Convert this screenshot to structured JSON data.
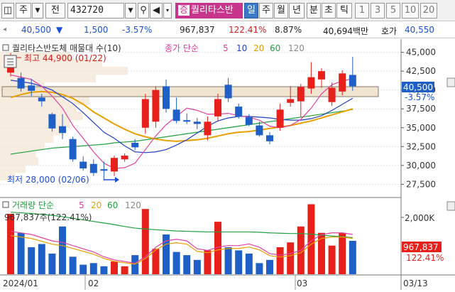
{
  "toolbar": {
    "type_label": "주",
    "prev_label": "전",
    "code": "432720",
    "stock_badge": "증",
    "stock_name": "퀄리타스반",
    "periods": [
      "일",
      "주",
      "월",
      "년",
      "분",
      "초",
      "틱"
    ],
    "selected_period": "일",
    "numbers": [
      "1",
      "3",
      "5",
      "10",
      "20"
    ]
  },
  "quote": {
    "price": "40,500",
    "change_arrow": "▼",
    "change": "1,500",
    "change_pct": "-3.57%",
    "volume": "967,837",
    "volume_ratio": "122.41%",
    "turnover": "8.87%",
    "amount": "40,694백만",
    "ask_label": "호가",
    "ask": "40,550"
  },
  "price_panel": {
    "title": "퀄리타스반도체 매물대 수(10)",
    "ma_label": "종가 단순",
    "ma_periods": [
      "5",
      "10",
      "20",
      "60",
      "120"
    ],
    "high_label": "최고 44,900 (01/22)",
    "low_label": "최저 28,000 (02/06)",
    "current_tag": "40,500",
    "current_pct": "-3.57%",
    "y_ticks": [
      "45,000",
      "42,500",
      "40,000",
      "37,500",
      "35,000",
      "32,500",
      "30,000",
      "27,500"
    ]
  },
  "volume_panel": {
    "title": "거래량 단순",
    "ma_periods": [
      "5",
      "20",
      "60",
      "120"
    ],
    "current_label": "967,837주(122.41%)",
    "y_tick": "2,000K",
    "current_tag": "967,837",
    "current_pct": "122.41%"
  },
  "x_labels": [
    "2024/01",
    "02",
    "03",
    "03/13"
  ],
  "colors": {
    "up": "#e8201c",
    "down": "#1e5fc8",
    "ma5": "#e040a0",
    "ma10": "#2040c0",
    "ma20": "#e8a000",
    "ma60": "#20a040",
    "ma120": "#888888"
  },
  "chart_data": {
    "type": "candlestick",
    "ylim": [
      26500,
      46000
    ],
    "candles": [
      {
        "o": 42300,
        "h": 44900,
        "l": 41800,
        "c": 43800
      },
      {
        "o": 41600,
        "h": 42300,
        "l": 39800,
        "c": 40200
      },
      {
        "o": 40600,
        "h": 41500,
        "l": 39200,
        "c": 39900
      },
      {
        "o": 39000,
        "h": 39500,
        "l": 37800,
        "c": 38500
      },
      {
        "o": 36800,
        "h": 37000,
        "l": 34500,
        "c": 34900
      },
      {
        "o": 35200,
        "h": 36800,
        "l": 33500,
        "c": 34300
      },
      {
        "o": 33500,
        "h": 33800,
        "l": 30500,
        "c": 30800
      },
      {
        "o": 30500,
        "h": 31200,
        "l": 29300,
        "c": 29600
      },
      {
        "o": 30200,
        "h": 30800,
        "l": 28600,
        "c": 29000
      },
      {
        "o": 29500,
        "h": 30500,
        "l": 28000,
        "c": 29300
      },
      {
        "o": 29200,
        "h": 31300,
        "l": 28600,
        "c": 31000
      },
      {
        "o": 30800,
        "h": 31600,
        "l": 30500,
        "c": 31300
      },
      {
        "o": 33000,
        "h": 33500,
        "l": 32000,
        "c": 32400
      },
      {
        "o": 35000,
        "h": 39500,
        "l": 34200,
        "c": 38800
      },
      {
        "o": 35800,
        "h": 40500,
        "l": 35000,
        "c": 40000
      },
      {
        "o": 40500,
        "h": 41400,
        "l": 37000,
        "c": 37500
      },
      {
        "o": 37400,
        "h": 39000,
        "l": 35600,
        "c": 35900
      },
      {
        "o": 36000,
        "h": 36900,
        "l": 35500,
        "c": 35800
      },
      {
        "o": 35800,
        "h": 36300,
        "l": 34800,
        "c": 35500
      },
      {
        "o": 34000,
        "h": 36500,
        "l": 33300,
        "c": 35800
      },
      {
        "o": 36500,
        "h": 39500,
        "l": 35800,
        "c": 38800
      },
      {
        "o": 40700,
        "h": 41600,
        "l": 38400,
        "c": 38900
      },
      {
        "o": 37800,
        "h": 38200,
        "l": 36200,
        "c": 36500
      },
      {
        "o": 36400,
        "h": 36800,
        "l": 35200,
        "c": 35400
      },
      {
        "o": 35300,
        "h": 35800,
        "l": 33800,
        "c": 34000
      },
      {
        "o": 34000,
        "h": 34400,
        "l": 32800,
        "c": 33200
      },
      {
        "o": 35000,
        "h": 38200,
        "l": 34600,
        "c": 37400
      },
      {
        "o": 38300,
        "h": 40500,
        "l": 37800,
        "c": 38800
      },
      {
        "o": 38500,
        "h": 40800,
        "l": 36400,
        "c": 40400
      },
      {
        "o": 40200,
        "h": 43700,
        "l": 39500,
        "c": 41700
      },
      {
        "o": 41400,
        "h": 42900,
        "l": 40300,
        "c": 42500
      },
      {
        "o": 38400,
        "h": 41000,
        "l": 37900,
        "c": 40300
      },
      {
        "o": 39800,
        "h": 42600,
        "l": 39300,
        "c": 42200
      },
      {
        "o": 42000,
        "h": 44400,
        "l": 39900,
        "c": 40500
      }
    ],
    "ma5": [
      42000,
      41700,
      41400,
      40500,
      39200,
      37600,
      35300,
      33600,
      31800,
      30300,
      29600,
      29700,
      30300,
      32100,
      33900,
      35400,
      36500,
      37600,
      37300,
      36800,
      36800,
      36900,
      36600,
      36400,
      36000,
      35200,
      35000,
      35300,
      36100,
      37600,
      39500,
      40700,
      41200,
      41500
    ],
    "ma10": [
      41300,
      41100,
      40900,
      40500,
      40000,
      39100,
      38200,
      37000,
      35700,
      34400,
      33600,
      32600,
      31800,
      31700,
      31800,
      32100,
      32700,
      33400,
      34300,
      35200,
      35900,
      36300,
      36500,
      36500,
      36400,
      36300,
      36100,
      36000,
      36000,
      36200,
      36600,
      37300,
      38100,
      38900
    ],
    "ma20": [
      39000,
      39400,
      39700,
      39800,
      39700,
      39400,
      38900,
      38100,
      37100,
      36300,
      35500,
      34800,
      34200,
      33800,
      33500,
      33300,
      33200,
      33300,
      33400,
      33600,
      33900,
      34200,
      34400,
      34500,
      34700,
      34900,
      35100,
      35300,
      35600,
      35900,
      36300,
      36700,
      37100,
      37500
    ],
    "ma60": [
      31500,
      31700,
      31900,
      32100,
      32300,
      32400,
      32500,
      32600,
      32700,
      32800,
      33000,
      33100,
      33200,
      33400,
      33600,
      33800,
      34000,
      34200,
      34400,
      34600,
      34800,
      35000,
      35200,
      35400,
      35600,
      35800,
      36000,
      36200,
      36400,
      36600,
      36800,
      37000,
      37200,
      37400
    ],
    "volumes": [
      1900,
      1300,
      850,
      950,
      650,
      1500,
      550,
      300,
      350,
      250,
      400,
      250,
      600,
      2050,
      800,
      1250,
      700,
      600,
      450,
      750,
      1650,
      850,
      750,
      650,
      350,
      450,
      850,
      1000,
      1500,
      2200,
      1300,
      900,
      1300,
      1050
    ],
    "vol_ma20": [
      1950,
      1930,
      1910,
      1880,
      1850,
      1810,
      1760,
      1710,
      1660,
      1610,
      1560,
      1500,
      1450,
      1420,
      1400,
      1380,
      1360,
      1350,
      1340,
      1330,
      1330,
      1330,
      1330,
      1330,
      1320,
      1300,
      1290,
      1280,
      1280,
      1260,
      1230,
      1200,
      1180,
      1150
    ],
    "vol_ma5": [
      1350,
      1300,
      1250,
      1150,
      1050,
      1000,
      900,
      800,
      700,
      550,
      450,
      400,
      350,
      550,
      850,
      1050,
      1100,
      1050,
      800,
      750,
      850,
      900,
      900,
      950,
      850,
      650,
      600,
      650,
      750,
      1050,
      1250,
      1300,
      1300,
      1250
    ],
    "volume_profile": [
      {
        "price": 44500,
        "w": 0.55
      },
      {
        "price": 43500,
        "w": 0.8
      },
      {
        "price": 42500,
        "w": 1.0
      },
      {
        "price": 41500,
        "w": 0.75
      },
      {
        "price": 40500,
        "w": 0.35
      },
      {
        "price": 39500,
        "w": 0.55
      },
      {
        "price": 38500,
        "w": 0.7
      },
      {
        "price": 37500,
        "w": 0.6
      },
      {
        "price": 36500,
        "w": 0.65
      },
      {
        "price": 35500,
        "w": 0.55
      },
      {
        "price": 34500,
        "w": 0.5
      },
      {
        "price": 33500,
        "w": 0.42
      },
      {
        "price": 32500,
        "w": 0.35
      },
      {
        "price": 31500,
        "w": 0.28
      },
      {
        "price": 30500,
        "w": 0.3
      },
      {
        "price": 29500,
        "w": 0.2
      },
      {
        "price": 28500,
        "w": 0.12
      }
    ]
  }
}
